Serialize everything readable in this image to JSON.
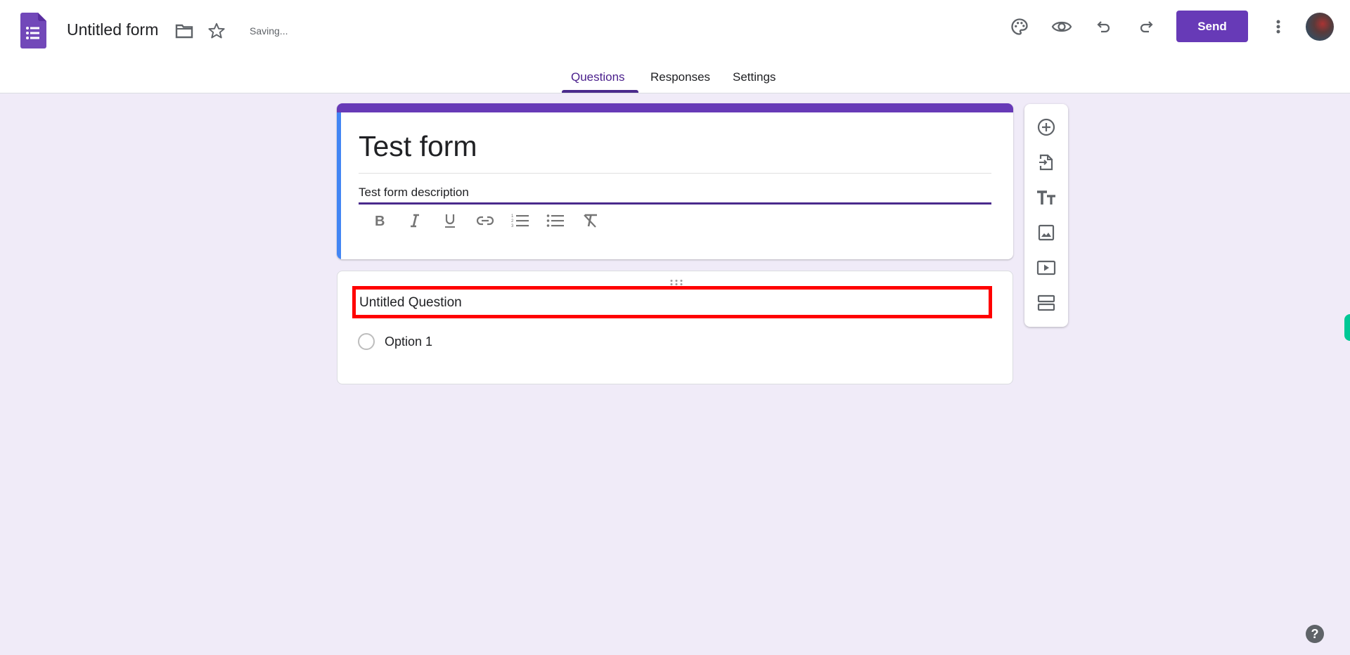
{
  "header": {
    "app_icon": "google-forms-logo",
    "doc_title": "Untitled form",
    "folder_icon": "folder-icon",
    "star_icon": "star-icon",
    "status": "Saving...",
    "actions": [
      {
        "name": "customize-theme",
        "icon": "palette-icon"
      },
      {
        "name": "preview",
        "icon": "eye-icon"
      },
      {
        "name": "undo",
        "icon": "undo-icon"
      },
      {
        "name": "redo",
        "icon": "redo-icon"
      }
    ],
    "send_label": "Send",
    "more_icon": "more-vert-icon",
    "avatar": "user-avatar"
  },
  "tabs": [
    {
      "label": "Questions",
      "active": true
    },
    {
      "label": "Responses",
      "active": false
    },
    {
      "label": "Settings",
      "active": false
    }
  ],
  "form": {
    "title": "Test form",
    "description": "Test form description",
    "format_toolbar": [
      "bold",
      "italic",
      "underline",
      "link",
      "numbered-list",
      "bulleted-list",
      "clear-formatting"
    ],
    "question": {
      "title": "Untitled Question",
      "options": [
        "Option 1"
      ]
    }
  },
  "side_toolbar": [
    {
      "name": "add-question",
      "icon": "add-circle-icon"
    },
    {
      "name": "import-questions",
      "icon": "import-icon"
    },
    {
      "name": "add-title-description",
      "icon": "text-title-icon"
    },
    {
      "name": "add-image",
      "icon": "image-icon"
    },
    {
      "name": "add-video",
      "icon": "video-icon"
    },
    {
      "name": "add-section",
      "icon": "section-icon"
    }
  ],
  "colors": {
    "accent": "#673ab7",
    "background": "#f0ebf8",
    "highlight": "#ff0000",
    "left_bar": "#4285f4"
  },
  "help": "?"
}
